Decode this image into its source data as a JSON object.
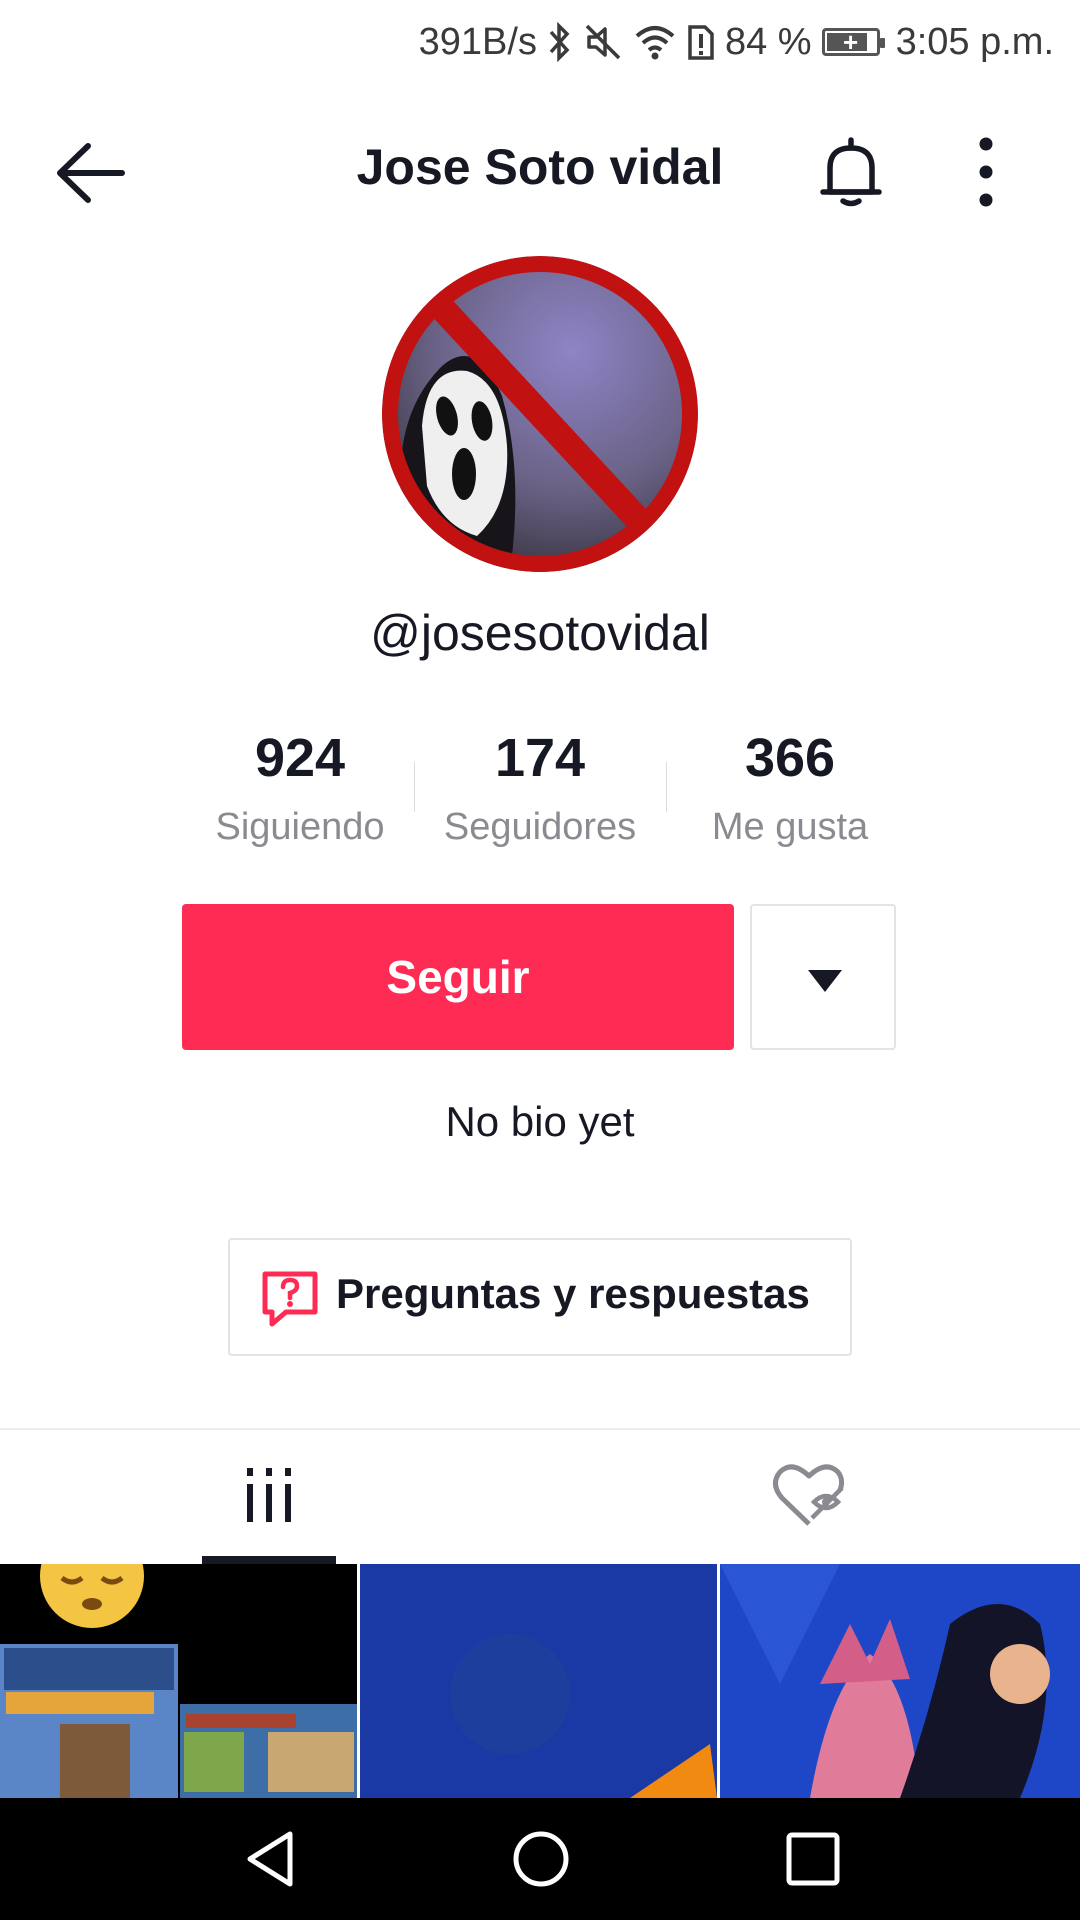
{
  "status_bar": {
    "net_speed": "391B/s",
    "battery": "84 %",
    "battery_level": 0.84,
    "time": "3:05 p.m.",
    "icons": [
      "bluetooth-icon",
      "mute-icon",
      "wifi-icon",
      "sim-alert-icon",
      "battery-icon"
    ]
  },
  "header": {
    "title": "Jose Soto vidal",
    "icons": [
      "back-arrow-icon",
      "bell-icon",
      "more-vertical-icon"
    ]
  },
  "profile": {
    "username": "@josesotovidal",
    "stats": [
      {
        "value": "924",
        "label": "Siguiendo"
      },
      {
        "value": "174",
        "label": "Seguidores"
      },
      {
        "value": "366",
        "label": "Me gusta"
      }
    ],
    "follow_label": "Seguir",
    "bio": "No bio yet",
    "qa_label": "Preguntas y respuestas"
  },
  "colors": {
    "accent": "#fe2c55",
    "text": "#161823",
    "muted": "#8a8b91"
  },
  "tabs": {
    "icons": [
      "videos-grid-icon",
      "liked-hidden-icon"
    ],
    "active": 0
  }
}
